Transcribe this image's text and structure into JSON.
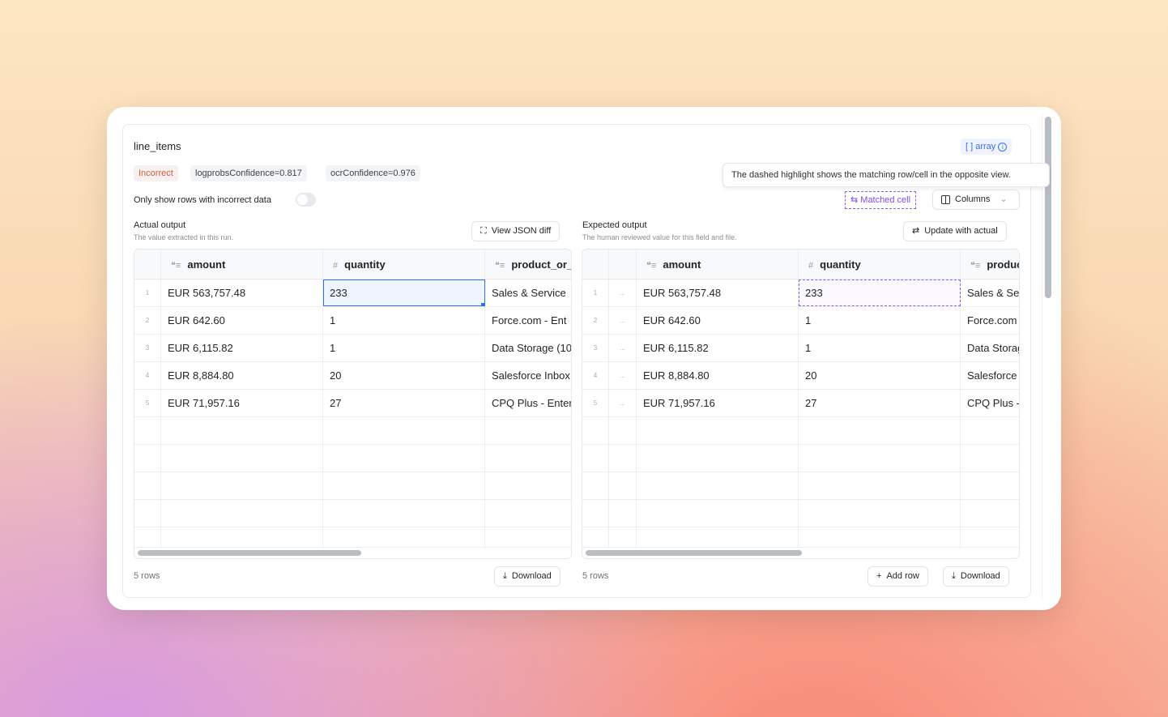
{
  "field": {
    "name": "line_items",
    "type_label": "array"
  },
  "badges": {
    "status": "Incorrect",
    "logprobs": "logprobsConfidence=0.817",
    "ocr": "ocrConfidence=0.976"
  },
  "filter": {
    "label": "Only show rows with incorrect data",
    "enabled": false
  },
  "tooltip": "The dashed highlight shows the matching row/cell in the opposite view.",
  "toolbar": {
    "matched_cell": "Matched cell",
    "columns": "Columns"
  },
  "actual": {
    "title": "Actual output",
    "subtitle": "The value extracted in this run.",
    "view_json_diff": "View JSON diff",
    "row_count": "5 rows",
    "download": "Download"
  },
  "expected": {
    "title": "Expected output",
    "subtitle": "The human reviewed value for this field and file.",
    "update": "Update with actual",
    "row_count": "5 rows",
    "add_row": "Add row",
    "download": "Download",
    "row_menu": "..."
  },
  "columns": [
    "amount",
    "quantity",
    "product_or_"
  ],
  "rows": [
    {
      "n": "1",
      "amount": "EUR 563,757.48",
      "quantity": "233",
      "product": "Sales & Service"
    },
    {
      "n": "2",
      "amount": "EUR 642.60",
      "quantity": "1",
      "product": "Force.com - Ent"
    },
    {
      "n": "3",
      "amount": "EUR 6,115.82",
      "quantity": "1",
      "product": "Data Storage (10"
    },
    {
      "n": "4",
      "amount": "EUR 8,884.80",
      "quantity": "20",
      "product": "Salesforce Inbox"
    },
    {
      "n": "5",
      "amount": "EUR 71,957.16",
      "quantity": "27",
      "product": "CPQ Plus - Enter"
    }
  ]
}
